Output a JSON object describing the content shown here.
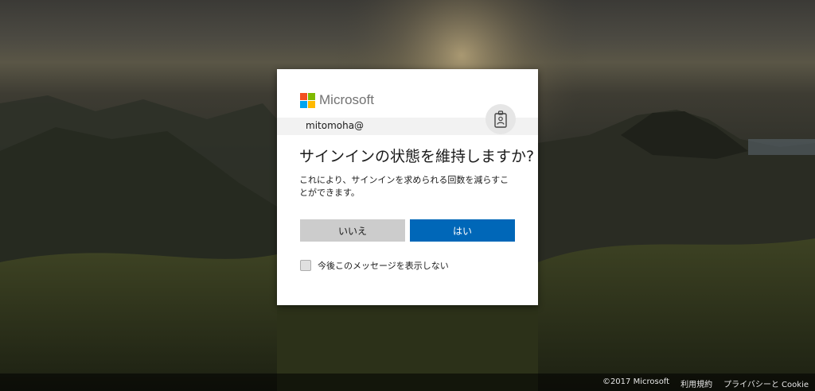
{
  "brand": {
    "name": "Microsoft",
    "colors": {
      "red": "#f25022",
      "green": "#7fba00",
      "blue": "#00a4ef",
      "yellow": "#ffb900"
    }
  },
  "identity": {
    "account": "mitomoha@",
    "badge_icon": "id-badge-icon"
  },
  "dialog": {
    "title": "サインインの状態を維持しますか?",
    "description": "これにより、サインインを求められる回数を減らすことができます。",
    "no_label": "いいえ",
    "yes_label": "はい",
    "dont_show_label": "今後このメッセージを表示しない",
    "dont_show_checked": false,
    "accent_color": "#0067b8"
  },
  "footer": {
    "copyright": "©2017 Microsoft",
    "terms": "利用規約",
    "privacy": "プライバシーと Cookie"
  }
}
